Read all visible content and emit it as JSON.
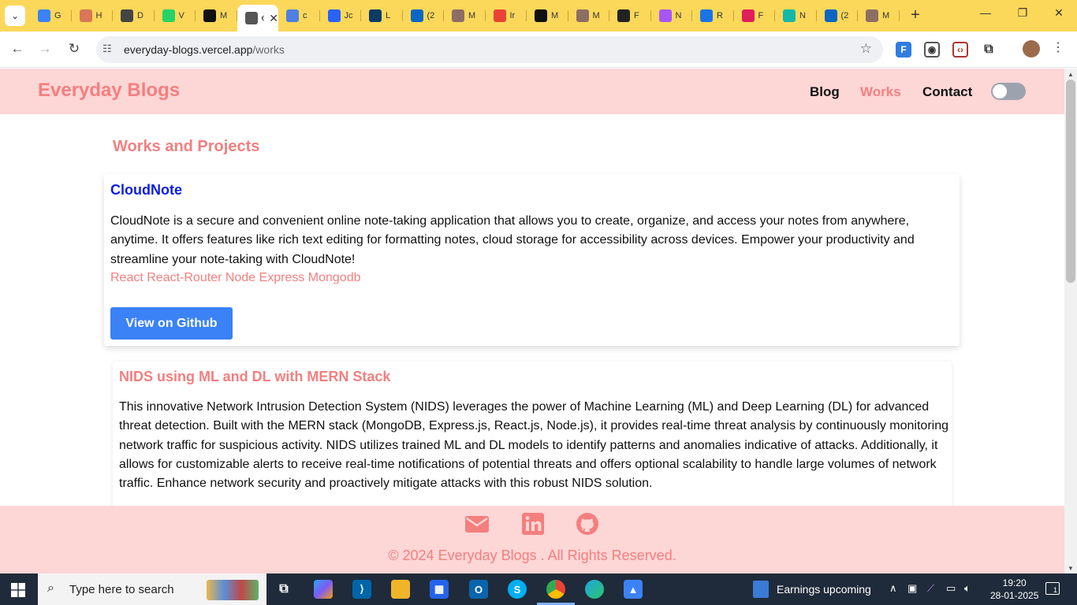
{
  "browser": {
    "tabs": [
      {
        "label": "G",
        "icon": "sparkle-icon",
        "color": "#3b82f6"
      },
      {
        "label": "H",
        "icon": "claude-icon",
        "color": "#d97757"
      },
      {
        "label": "D",
        "icon": "openai-icon",
        "color": "#444444"
      },
      {
        "label": "V",
        "icon": "whatsapp-icon",
        "color": "#25d366"
      },
      {
        "label": "M",
        "icon": "github-icon",
        "color": "#111111"
      },
      {
        "label": "e",
        "icon": "site-icon",
        "color": "#555555",
        "active": true
      },
      {
        "label": "c",
        "icon": "puzzle-icon",
        "color": "#4f7fe0"
      },
      {
        "label": "Jc",
        "icon": "info-icon",
        "color": "#2962ff"
      },
      {
        "label": "L",
        "icon": "fv-icon",
        "color": "#0d3b66"
      },
      {
        "label": "(2",
        "icon": "linkedin-icon",
        "color": "#0a66c2"
      },
      {
        "label": "M",
        "icon": "avatar-icon",
        "color": "#8d6e63"
      },
      {
        "label": "Ir",
        "icon": "gmail-icon",
        "color": "#ea4335"
      },
      {
        "label": "M",
        "icon": "github-icon",
        "color": "#111111"
      },
      {
        "label": "M",
        "icon": "avatar-icon",
        "color": "#8d6e63"
      },
      {
        "label": "F",
        "icon": "webflow-icon",
        "color": "#222222"
      },
      {
        "label": "N",
        "icon": "arc-icon",
        "color": "#a855f7"
      },
      {
        "label": "R",
        "icon": "r-icon",
        "color": "#1a73e8"
      },
      {
        "label": "F",
        "icon": "slack-icon",
        "color": "#e01e5a"
      },
      {
        "label": "N",
        "icon": "circle-icon",
        "color": "#14b8a6"
      },
      {
        "label": "(2",
        "icon": "linkedin-icon",
        "color": "#0a66c2"
      },
      {
        "label": "M",
        "icon": "avatar-icon",
        "color": "#8d6e63"
      }
    ],
    "active_tab_close": "✕",
    "url_host": "everyday-blogs.vercel.app",
    "url_path": "/works"
  },
  "site": {
    "brand": "Everyday Blogs",
    "nav": [
      {
        "label": "Blog"
      },
      {
        "label": "Works"
      },
      {
        "label": "Contact"
      }
    ],
    "section_title": "Works and Projects",
    "projects": [
      {
        "title": "CloudNote",
        "description": "CloudNote is a secure and convenient online note-taking application that allows you to create, organize, and access your notes from anywhere, anytime. It offers features like rich text editing for formatting notes, cloud storage for accessibility across devices. Empower your productivity and streamline your note-taking with CloudNote!",
        "tech": "React React-Router Node Express Mongodb",
        "button": "View on Github"
      },
      {
        "title": "NIDS using ML and DL with MERN Stack",
        "description": "This innovative Network Intrusion Detection System (NIDS) leverages the power of Machine Learning (ML) and Deep Learning (DL) for advanced threat detection. Built with the MERN stack (MongoDB, Express.js, React.js, Node.js), it provides real-time threat analysis by continuously monitoring network traffic for suspicious activity. NIDS utilizes trained ML and DL models to identify patterns and anomalies indicative of attacks. Additionally, it allows for customizable alerts to receive real-time notifications of potential threats and offers optional scalability to handle large volumes of network traffic. Enhance network security and proactively mitigate attacks with this robust NIDS solution."
      }
    ],
    "footer": {
      "icons": [
        "mail-icon",
        "linkedin-icon",
        "github-icon"
      ],
      "copyright": "© 2024 Everyday Blogs . All Rights Reserved."
    },
    "colors": {
      "accent": "#f47f7f",
      "header_bg": "#fdd6d6",
      "link_blue": "#0b1ee3",
      "button_blue": "#3b82f6"
    }
  },
  "taskbar": {
    "search_placeholder": "Type here to search",
    "news": "Earnings upcoming",
    "time": "19:20",
    "date": "28-01-2025",
    "notification_count": "1"
  }
}
